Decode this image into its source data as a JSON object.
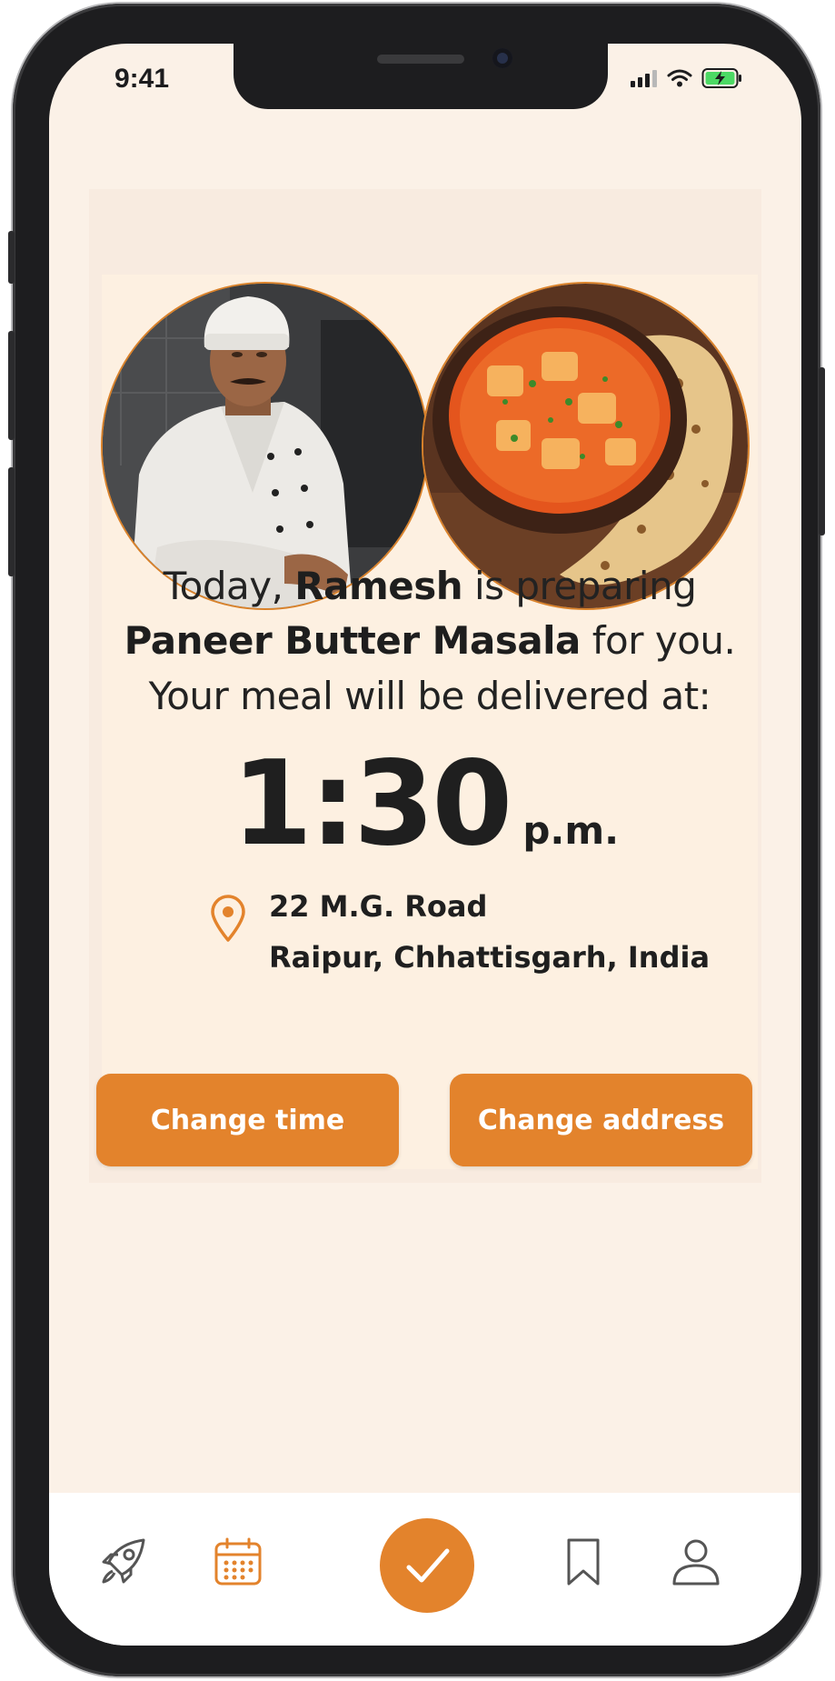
{
  "status_bar": {
    "time": "9:41"
  },
  "message": {
    "line1_prefix": "Today, ",
    "chef_name": "Ramesh",
    "line1_suffix": " is preparing",
    "dish_name": "Paneer Butter Masala",
    "line2_suffix": " for you.",
    "line3": "Your meal will be delivered at:"
  },
  "delivery": {
    "time": "1:30",
    "period": "p.m."
  },
  "address": {
    "line1": "22 M.G. Road",
    "line2": "Raipur, Chhattisgarh, India"
  },
  "actions": {
    "change_time_label": "Change time",
    "change_address_label": "Change address"
  },
  "bottom_nav": {
    "items": [
      "rocket-icon",
      "calendar-icon",
      "check-icon",
      "bookmark-icon",
      "user-icon"
    ],
    "active": "check-icon"
  },
  "colors": {
    "accent": "#e3832c",
    "background": "#fbf1e7",
    "text": "#1f1f1f"
  }
}
